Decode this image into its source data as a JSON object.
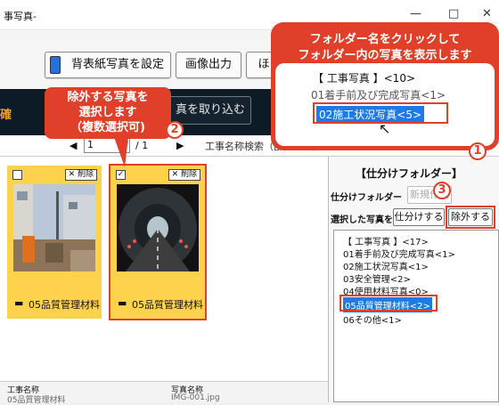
{
  "window": {
    "title": "事写真-",
    "min": "—",
    "max": "□",
    "close": "✕"
  },
  "toolbar": {
    "back_photo_button": "背表紙写真を設定",
    "print_button": "画像出力",
    "third_button": "ほ"
  },
  "dark": {
    "left_label": "確",
    "import_button": "真を取り込む"
  },
  "nav": {
    "page_value": "1",
    "page_total": "/ 1",
    "search_label": "工事名称検索（部分一致）"
  },
  "cards": [
    {
      "checked": "",
      "delete_label": "✕ 削除",
      "name": "05品質管理材料"
    },
    {
      "checked": "✓",
      "delete_label": "✕ 削除",
      "name": "05品質管理材料"
    }
  ],
  "bottom": {
    "col1_label": "工事名称",
    "col2_label": "写真名称",
    "col1_value": "05品質管理材料",
    "col2_value": "IMG-001.jpg"
  },
  "sort": {
    "title": "【仕分けフォルダー】",
    "row1_label": "仕分けフォルダー",
    "new_button": "新規作成",
    "row2_label": "選択した写真を",
    "sort_button": "仕分けする",
    "exclude_button": "除外する"
  },
  "tree": [
    "【 工事写真 】<17>",
    "01着手前及び完成写真<1>",
    "02施工状況写真<1>",
    "03安全管理<2>",
    "04使用材料写真<0>",
    "05品質管理材料<2>",
    "06その他<1>"
  ],
  "callout_left": {
    "line1": "除外する写真を",
    "line2": "選択します",
    "line3": "（複数選択可)",
    "badge": "2"
  },
  "callout_top": {
    "line1": "フォルダー名をクリックして",
    "line2": "フォルダー内の写真を表示します",
    "tree0": "【 工事写真 】<10>",
    "tree1": "01着手前及び完成写真<1>",
    "tree2": "02施工状況写真<5>",
    "badge": "1"
  },
  "badge3": "3",
  "colors": {
    "accent_red": "#e0402a",
    "card_yellow": "#ffd24d",
    "selection_blue": "#1e7ae6",
    "dark_bar": "#0d1b26"
  }
}
